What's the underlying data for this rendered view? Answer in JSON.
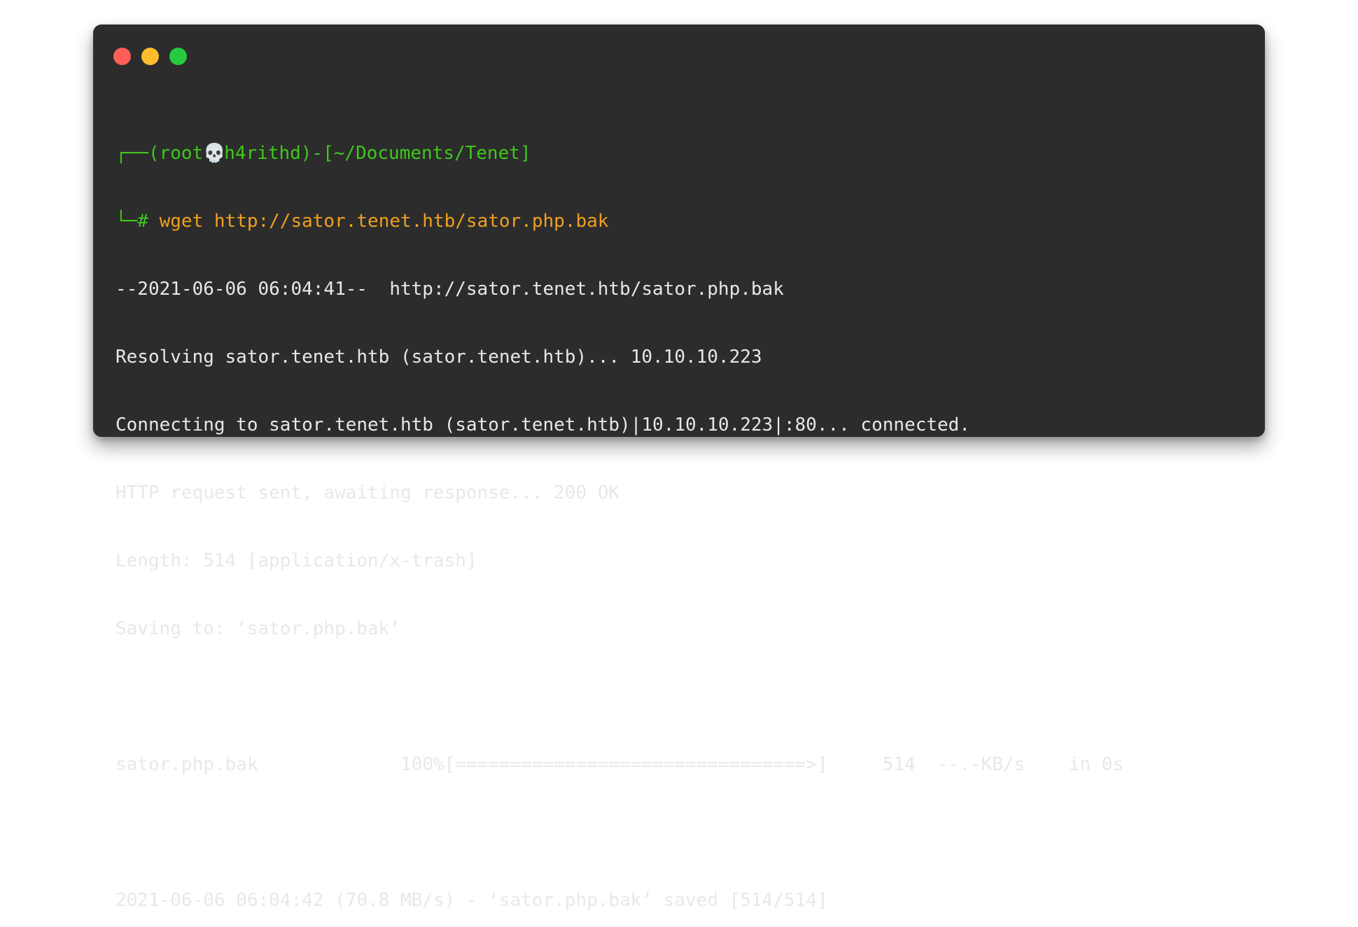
{
  "window": {
    "controls": {
      "close_color": "#ff5f56",
      "minimize_color": "#ffbd2e",
      "zoom_color": "#27c93f"
    }
  },
  "prompt": {
    "line1_prefix": "┌──(root",
    "skull_glyph": "💀",
    "line1_suffix": "h4rithd)-[~/Documents/Tenet]",
    "line2_prefix": "└─# ",
    "command": "wget http://sator.tenet.htb/sator.php.bak",
    "prompt_color": "#3ec81a",
    "command_color": "#f0a020"
  },
  "output": {
    "lines": [
      "--2021-06-06 06:04:41--  http://sator.tenet.htb/sator.php.bak",
      "Resolving sator.tenet.htb (sator.tenet.htb)... 10.10.10.223",
      "Connecting to sator.tenet.htb (sator.tenet.htb)|10.10.10.223|:80... connected.",
      "HTTP request sent, awaiting response... 200 OK",
      "Length: 514 [application/x-trash]",
      "Saving to: ‘sator.php.bak’",
      "",
      "sator.php.bak             100%[================================>]     514  --.-KB/s    in 0s",
      "",
      "2021-06-06 06:04:42 (70.8 MB/s) - ‘sator.php.bak’ saved [514/514]"
    ]
  }
}
